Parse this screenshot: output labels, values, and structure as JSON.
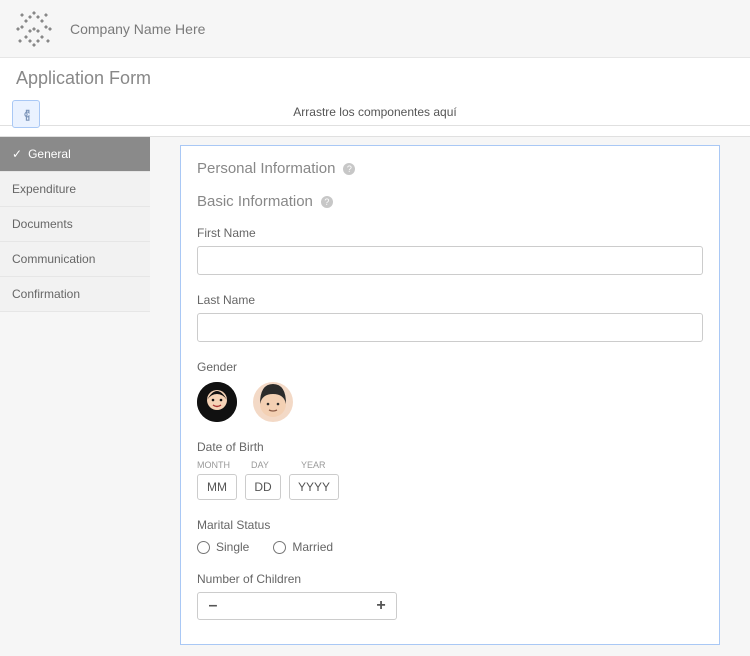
{
  "header": {
    "company_name": "Company Name Here"
  },
  "page": {
    "title": "Application Form",
    "drop_hint": "Arrastre los componentes aquí"
  },
  "sidebar": {
    "items": [
      {
        "label": "General",
        "active": true
      },
      {
        "label": "Expenditure",
        "active": false
      },
      {
        "label": "Documents",
        "active": false
      },
      {
        "label": "Communication",
        "active": false
      },
      {
        "label": "Confirmation",
        "active": false
      }
    ]
  },
  "form": {
    "sections": {
      "personal": "Personal Information",
      "basic": "Basic Information"
    },
    "fields": {
      "first_name": {
        "label": "First Name",
        "value": ""
      },
      "last_name": {
        "label": "Last Name",
        "value": ""
      },
      "gender": {
        "label": "Gender"
      },
      "dob": {
        "label": "Date of Birth",
        "month_header": "MONTH",
        "day_header": "DAY",
        "year_header": "YEAR",
        "month_placeholder": "MM",
        "day_placeholder": "DD",
        "year_placeholder": "YYYY"
      },
      "marital": {
        "label": "Marital Status",
        "options": [
          "Single",
          "Married"
        ]
      },
      "children": {
        "label": "Number of Children",
        "minus": "–",
        "plus": "+",
        "value": ""
      }
    }
  },
  "icons": {
    "check": "✓",
    "help": "?"
  }
}
